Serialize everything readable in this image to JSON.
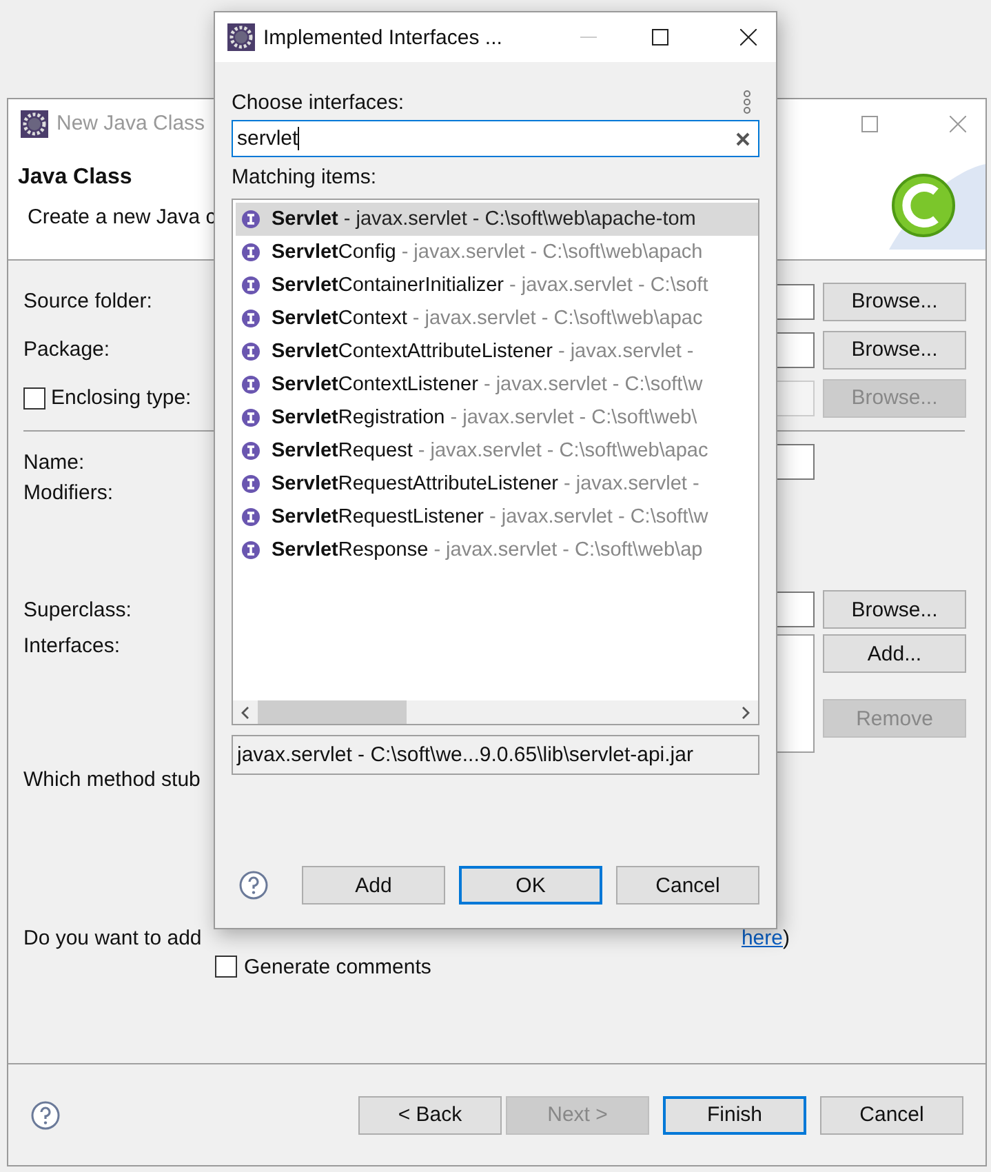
{
  "background_window": {
    "title": "New Java Class",
    "active": false,
    "header_title": "Java Class",
    "header_description": "Create a new Java c",
    "fields": [
      {
        "kind": "text",
        "label": "Source folder:",
        "button": "Browse...",
        "disabled": false
      },
      {
        "kind": "text",
        "label": "Package:",
        "button": "Browse...",
        "disabled": false
      },
      {
        "kind": "checkbox",
        "label": "Enclosing type:",
        "checked": false,
        "button": "Browse...",
        "disabled": true
      }
    ],
    "name_label": "Name:",
    "modifiers_label": "Modifiers:",
    "superclass": {
      "label": "Superclass:",
      "button": "Browse..."
    },
    "interfaces": {
      "label": "Interfaces:",
      "buttons": [
        {
          "label": "Add...",
          "disabled": false
        },
        {
          "label": "Remove",
          "disabled": true
        }
      ]
    },
    "method_stubs_label": "Which method stub",
    "comments": {
      "question": "Do you want to add",
      "link": "here",
      "closing": ")"
    },
    "generate_comments": {
      "label": "Generate comments",
      "checked": false
    },
    "footer_buttons": [
      {
        "label": "< Back",
        "disabled": false,
        "default": false
      },
      {
        "label": "Next >",
        "disabled": true,
        "default": false
      },
      {
        "label": "Finish",
        "disabled": false,
        "default": true
      },
      {
        "label": "Cancel",
        "disabled": false,
        "default": false
      }
    ]
  },
  "dialog": {
    "title": "Implemented Interfaces ...",
    "search_label": "Choose interfaces:",
    "search_value": "servlet",
    "list_label": "Matching items:",
    "items": [
      {
        "name": "**Servlet**",
        "detail": " - javax.servlet - C:\\soft\\web\\apache-tom",
        "selected": true
      },
      {
        "name": "**Servlet**Config",
        "detail": " - javax.servlet - C:\\soft\\web\\apach",
        "selected": false
      },
      {
        "name": "**Servlet**ContainerInitializer",
        "detail": " - javax.servlet - C:\\soft",
        "selected": false
      },
      {
        "name": "**Servlet**Context",
        "detail": " - javax.servlet - C:\\soft\\web\\apac",
        "selected": false
      },
      {
        "name": "**Servlet**ContextAttributeListener",
        "detail": " - javax.servlet -",
        "selected": false
      },
      {
        "name": "**Servlet**ContextListener",
        "detail": " - javax.servlet - C:\\soft\\w",
        "selected": false
      },
      {
        "name": "**Servlet**Registration",
        "detail": " - javax.servlet - C:\\soft\\web\\",
        "selected": false
      },
      {
        "name": "**Servlet**Request",
        "detail": " - javax.servlet - C:\\soft\\web\\apac",
        "selected": false
      },
      {
        "name": "**Servlet**RequestAttributeListener",
        "detail": " - javax.servlet -",
        "selected": false
      },
      {
        "name": "**Servlet**RequestListener",
        "detail": " - javax.servlet - C:\\soft\\w",
        "selected": false
      },
      {
        "name": "**Servlet**Response",
        "detail": " - javax.servlet - C:\\soft\\web\\ap",
        "selected": false
      }
    ],
    "status": "javax.servlet - C:\\soft\\we...9.0.65\\lib\\servlet-api.jar",
    "buttons": [
      {
        "label": "Add",
        "default": false
      },
      {
        "label": "OK",
        "default": true
      },
      {
        "label": "Cancel",
        "default": false
      }
    ]
  }
}
